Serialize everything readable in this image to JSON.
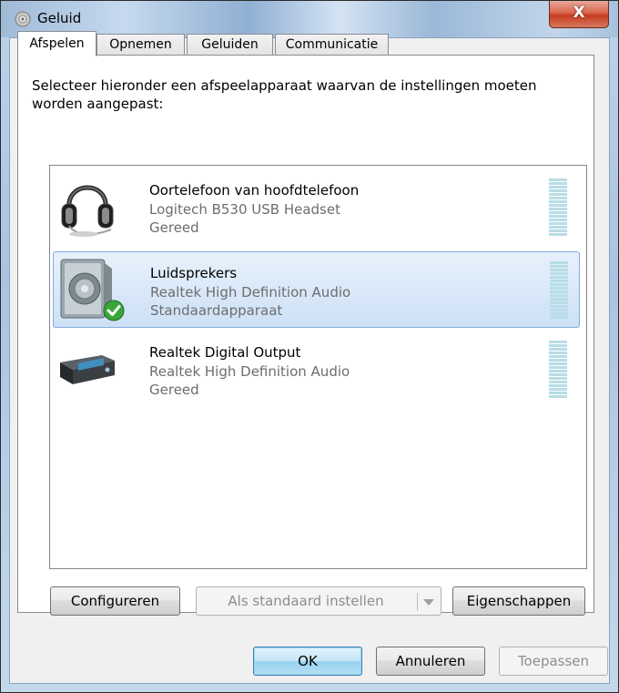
{
  "window": {
    "title": "Geluid",
    "close_glyph": "X"
  },
  "tabs": [
    {
      "label": "Afspelen",
      "active": true
    },
    {
      "label": "Opnemen",
      "active": false
    },
    {
      "label": "Geluiden",
      "active": false
    },
    {
      "label": "Communicatie",
      "active": false
    }
  ],
  "instruction": "Selecteer hieronder een afspeelapparaat waarvan de instellingen moeten worden aangepast:",
  "devices": [
    {
      "name": "Oortelefoon van hoofdtelefoon",
      "description": "Logitech B530 USB Headset",
      "status": "Gereed",
      "icon": "headset-icon",
      "selected": false
    },
    {
      "name": "Luidsprekers",
      "description": "Realtek High Definition Audio",
      "status": "Standaardapparaat",
      "icon": "speaker-icon",
      "selected": true,
      "default_badge_icon": "green-check-icon"
    },
    {
      "name": "Realtek Digital Output",
      "description": "Realtek High Definition Audio",
      "status": "Gereed",
      "icon": "digital-output-icon",
      "selected": false
    }
  ],
  "panel_buttons": {
    "configure": "Configureren",
    "set_default": "Als standaard instellen",
    "properties": "Eigenschappen"
  },
  "dialog_buttons": {
    "ok": "OK",
    "cancel": "Annuleren",
    "apply": "Toepassen"
  },
  "colors": {
    "selection_bg": "#cce0f6",
    "selection_border": "#84acdd",
    "meter": "#b8dde6",
    "close_button": "#c43c20"
  }
}
